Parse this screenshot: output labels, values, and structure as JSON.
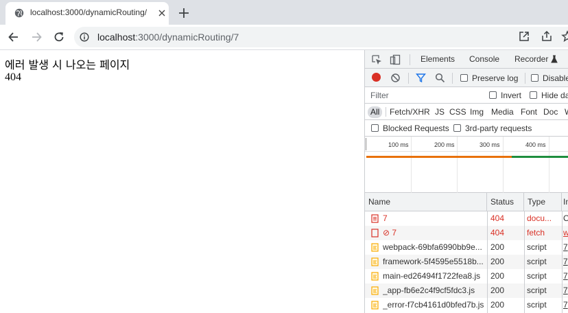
{
  "tab": {
    "title": "localhost:3000/dynamicRouting/",
    "favicon_icon": "globe-icon",
    "close_icon": "close-icon"
  },
  "new_tab_icon": "plus-icon",
  "address_bar": {
    "host": "localhost",
    "path": ":3000/dynamicRouting/7",
    "info_icon": "info-icon"
  },
  "toolbar_icons": [
    "open-in-new-icon",
    "share-icon",
    "star-icon"
  ],
  "page": {
    "line1": "에러 발생 시 나오는 페이지",
    "line2": "404"
  },
  "devtools": {
    "tabs": [
      "Elements",
      "Console",
      "Recorder"
    ],
    "toolbar": {
      "preserve_log": "Preserve log",
      "disable_cache": "Disable"
    },
    "filter": {
      "placeholder": "Filter",
      "invert": "Invert",
      "hide_data": "Hide da"
    },
    "types": [
      "All",
      "Fetch/XHR",
      "JS",
      "CSS",
      "Img",
      "Media",
      "Font",
      "Doc",
      "W"
    ],
    "blocked_requests": "Blocked Requests",
    "third_party": "3rd-party requests",
    "timeline_ticks": [
      "100 ms",
      "200 ms",
      "300 ms",
      "400 ms"
    ],
    "timeline_colors": {
      "waiting": "#e8710a",
      "content": "#1e8e3e"
    },
    "columns": [
      "Name",
      "Status",
      "Type",
      "In"
    ],
    "requests": [
      {
        "name": "7",
        "status": "404",
        "type": "docu...",
        "init": "O",
        "error": true,
        "icon": "document-icon"
      },
      {
        "name": "⊘ 7",
        "status": "404",
        "type": "fetch",
        "init": "w",
        "error": true,
        "icon": "fetch-icon"
      },
      {
        "name": "webpack-69bfa6990bb9e...",
        "status": "200",
        "type": "script",
        "init": "7",
        "error": false,
        "icon": "script-icon"
      },
      {
        "name": "framework-5f4595e5518b...",
        "status": "200",
        "type": "script",
        "init": "7",
        "error": false,
        "icon": "script-icon"
      },
      {
        "name": "main-ed26494f1722fea8.js",
        "status": "200",
        "type": "script",
        "init": "7",
        "error": false,
        "icon": "script-icon"
      },
      {
        "name": "_app-fb6e2c4f9cf5fdc3.js",
        "status": "200",
        "type": "script",
        "init": "7",
        "error": false,
        "icon": "script-icon"
      },
      {
        "name": "_error-f7cb4161d0bfed7b.js",
        "status": "200",
        "type": "script",
        "init": "7",
        "error": false,
        "icon": "script-icon"
      }
    ],
    "colors": {
      "error": "#d93025",
      "record": "#d93025",
      "accent": "#1a73e8",
      "script_icon": "#f9ab00"
    }
  }
}
